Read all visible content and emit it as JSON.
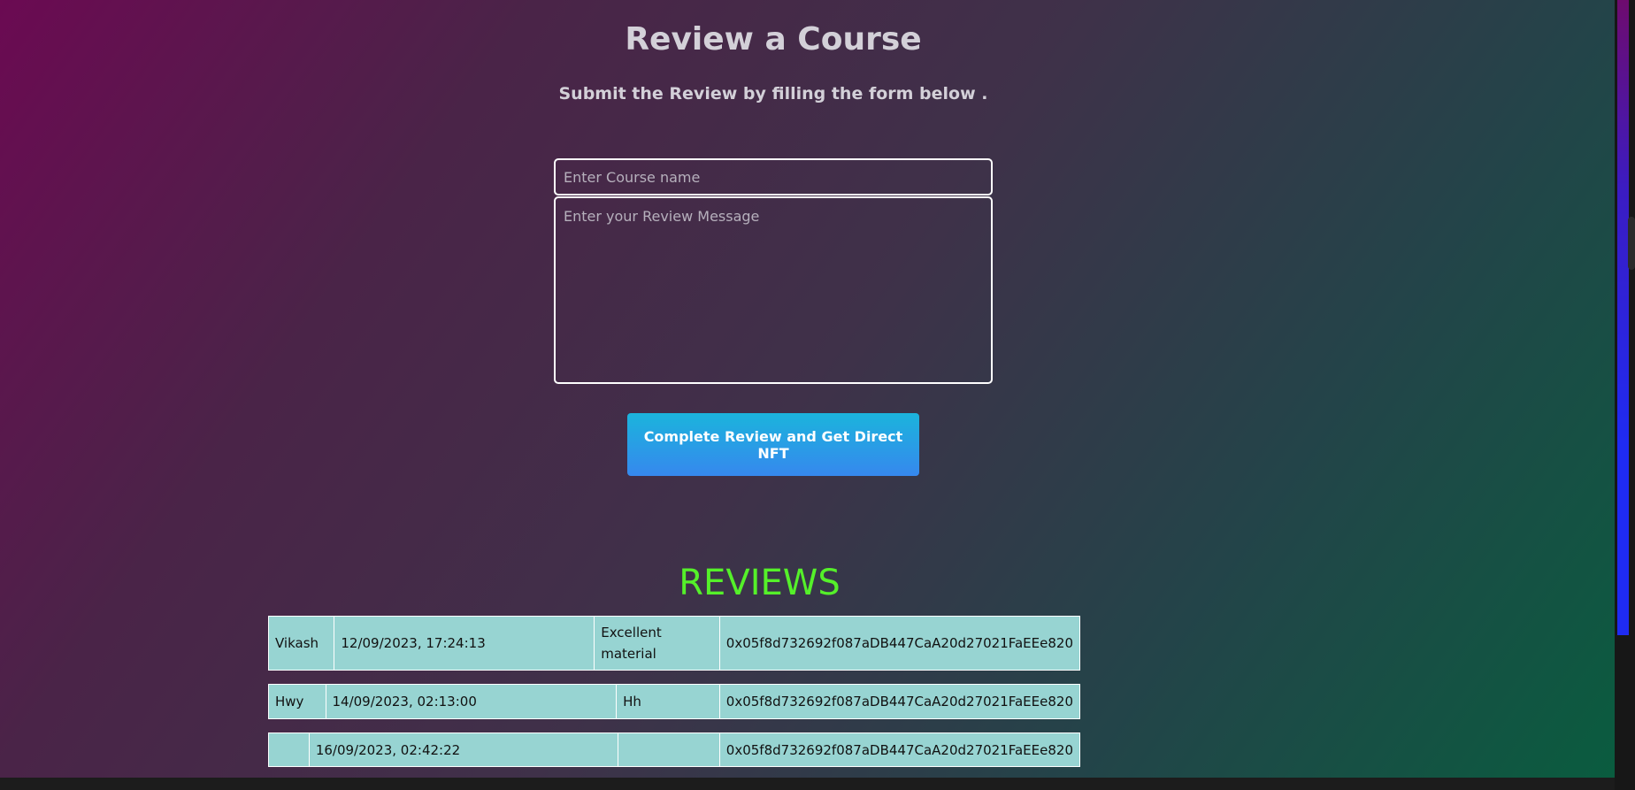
{
  "header": {
    "title": "Review a Course",
    "subtitle": "Submit the Review by filling the form below ."
  },
  "form": {
    "course_name": {
      "value": "",
      "placeholder": "Enter Course name"
    },
    "review_message": {
      "value": "",
      "placeholder": "Enter your Review Message"
    },
    "submit_label": "Complete Review and Get Direct NFT"
  },
  "reviews": {
    "heading": "REVIEWS",
    "rows": [
      {
        "name": "Vikash",
        "timestamp": "12/09/2023, 17:24:13",
        "message": "Excellent material",
        "address": "0x05f8d732692f087aDB447CaA20d27021FaEEe820"
      },
      {
        "name": "Hwy",
        "timestamp": "14/09/2023, 02:13:00",
        "message": "Hh",
        "address": "0x05f8d732692f087aDB447CaA20d27021FaEEe820"
      },
      {
        "name": "",
        "timestamp": "16/09/2023, 02:42:22",
        "message": "",
        "address": "0x05f8d732692f087aDB447CaA20d27021FaEEe820"
      }
    ]
  },
  "colors": {
    "title_text": "#d3d0d8",
    "reviews_heading": "#55f02a",
    "table_background": "#97d4d2",
    "button_gradient_top": "#1bb4dc",
    "button_gradient_bottom": "#3688ee"
  }
}
